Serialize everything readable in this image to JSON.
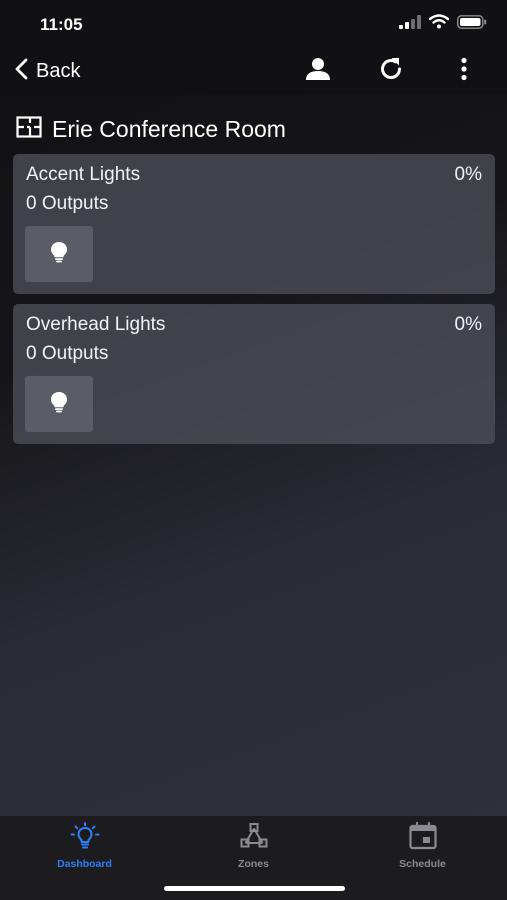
{
  "status_bar": {
    "time": "11:05",
    "icons": [
      "signal-icon",
      "wifi-icon",
      "battery-icon"
    ]
  },
  "nav": {
    "back_label": "Back",
    "icons": [
      "user-icon",
      "refresh-icon",
      "more-vertical-icon"
    ]
  },
  "room": {
    "title": "Erie Conference Room",
    "icon": "floorplan-icon"
  },
  "zones": [
    {
      "name": "Accent Lights",
      "level": "0%",
      "outputs": "0 Outputs",
      "icon": "lightbulb-icon"
    },
    {
      "name": "Overhead Lights",
      "level": "0%",
      "outputs": "0 Outputs",
      "icon": "lightbulb-icon"
    }
  ],
  "tabs": [
    {
      "label": "Dashboard",
      "icon": "lightbulb-outline-icon",
      "active": true
    },
    {
      "label": "Zones",
      "icon": "zones-network-icon",
      "active": false
    },
    {
      "label": "Schedule",
      "icon": "calendar-icon",
      "active": false
    }
  ],
  "colors": {
    "accent": "#2f7ef6",
    "tab_inactive": "#8a8a91",
    "card_bg": "#4e4e58",
    "button_bg": "#5b5c66"
  }
}
